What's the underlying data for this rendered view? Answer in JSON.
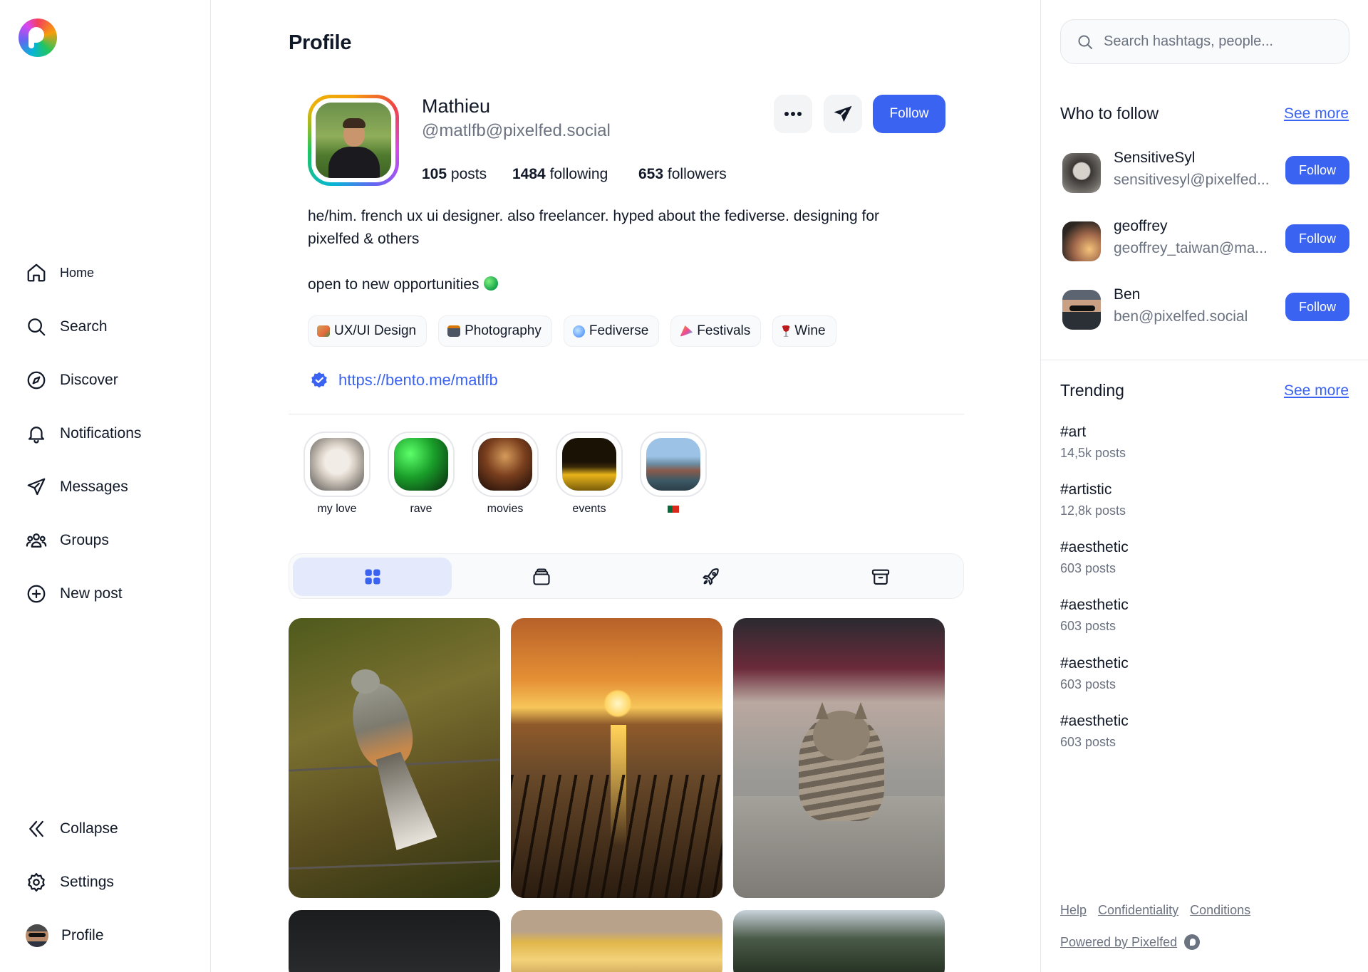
{
  "app": {
    "name": "Pixelfed",
    "accent": "#3b63f2"
  },
  "nav": {
    "home": "Home",
    "search": "Search",
    "discover": "Discover",
    "notifications": "Notifications",
    "messages": "Messages",
    "groups": "Groups",
    "new_post": "New post",
    "collapse": "Collapse",
    "settings": "Settings",
    "profile": "Profile"
  },
  "page": {
    "title": "Profile"
  },
  "profile": {
    "display_name": "Mathieu",
    "handle": "@matlfb@pixelfed.social",
    "stats": {
      "posts_count": "105",
      "posts_label": "posts",
      "following_count": "1484",
      "following_label": "following",
      "followers_count": "653",
      "followers_label": "followers"
    },
    "follow_label": "Follow",
    "bio_line1": "he/him. french ux ui designer. also freelancer. hyped about the fediverse. designing for",
    "bio_line2": "pixelfed & others",
    "bio_line3": "open to new opportunities",
    "tags": [
      "UX/UI Design",
      "Photography",
      "Fediverse",
      "Festivals",
      "Wine"
    ],
    "website": "https://bento.me/matlfb"
  },
  "highlights": [
    {
      "label": "my love"
    },
    {
      "label": "rave"
    },
    {
      "label": "movies"
    },
    {
      "label": "events"
    }
  ],
  "search": {
    "placeholder": "Search hashtags, people..."
  },
  "who_to_follow": {
    "title": "Who to follow",
    "see_more": "See more",
    "follow_label": "Follow",
    "accounts": [
      {
        "name": "SensitiveSyl",
        "handle": "sensitivesyl@pixelfed..."
      },
      {
        "name": "geoffrey",
        "handle": "geoffrey_taiwan@ma..."
      },
      {
        "name": "Ben",
        "handle": "ben@pixelfed.social"
      }
    ]
  },
  "trending": {
    "title": "Trending",
    "see_more": "See more",
    "items": [
      {
        "tag": "#art",
        "count": "14,5k posts"
      },
      {
        "tag": "#artistic",
        "count": "12,8k posts"
      },
      {
        "tag": "#aesthetic",
        "count": "603 posts"
      },
      {
        "tag": "#aesthetic",
        "count": "603 posts"
      },
      {
        "tag": "#aesthetic",
        "count": "603 posts"
      },
      {
        "tag": "#aesthetic",
        "count": "603 posts"
      }
    ]
  },
  "footer": {
    "help": "Help",
    "confidentiality": "Confidentiality",
    "conditions": "Conditions",
    "powered_by": "Powered by Pixelfed"
  }
}
